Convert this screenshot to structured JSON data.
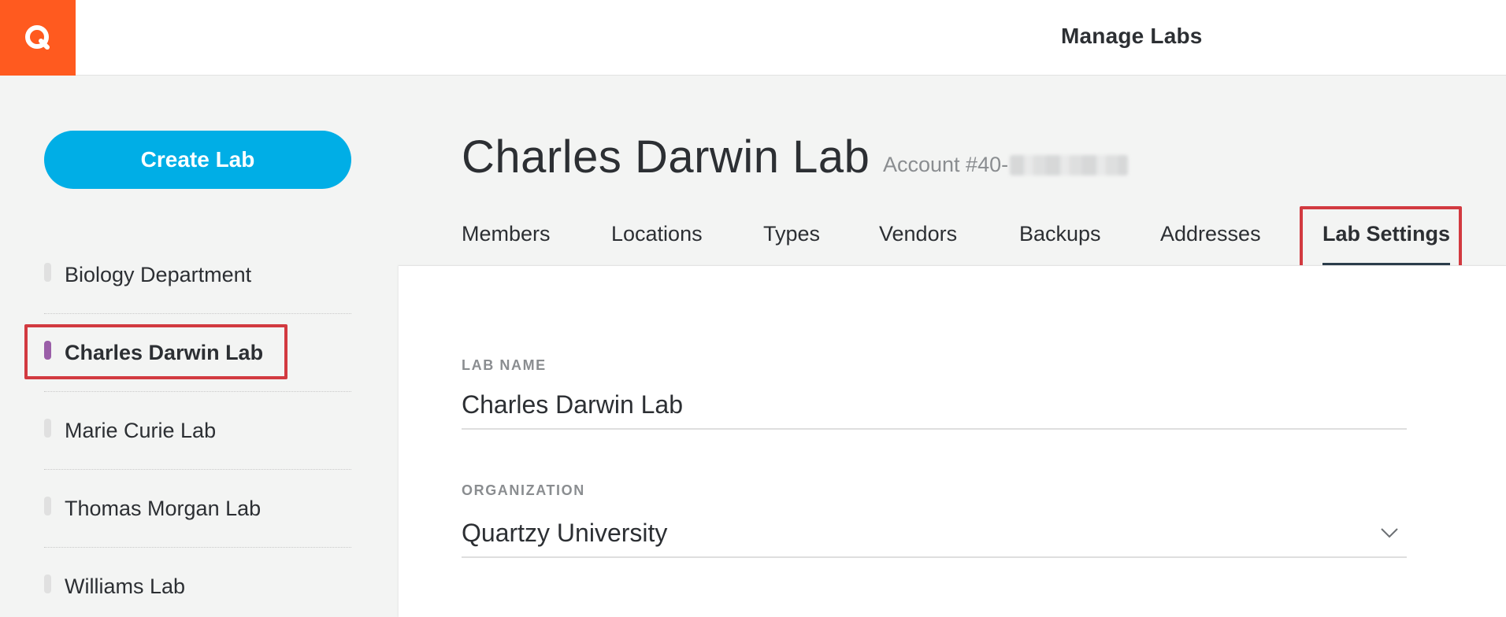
{
  "app": {
    "header_title": "Manage Labs"
  },
  "sidebar": {
    "create_label": "Create Lab",
    "items": [
      {
        "label": "Biology Department",
        "active": false
      },
      {
        "label": "Charles Darwin Lab",
        "active": true
      },
      {
        "label": "Marie Curie Lab",
        "active": false
      },
      {
        "label": "Thomas Morgan Lab",
        "active": false
      },
      {
        "label": "Williams Lab",
        "active": false
      }
    ]
  },
  "main": {
    "title": "Charles Darwin Lab",
    "account_prefix": "Account #40-",
    "tabs": [
      {
        "label": "Members"
      },
      {
        "label": "Locations"
      },
      {
        "label": "Types"
      },
      {
        "label": "Vendors"
      },
      {
        "label": "Backups"
      },
      {
        "label": "Addresses"
      },
      {
        "label": "Lab Settings",
        "active": true
      }
    ],
    "form": {
      "lab_name_label": "LAB NAME",
      "lab_name_value": "Charles Darwin Lab",
      "organization_label": "ORGANIZATION",
      "organization_value": "Quartzy University"
    }
  },
  "colors": {
    "brand": "#ff5a1f",
    "primary_button": "#00aee6",
    "active_lab_marker": "#9a5ea8",
    "highlight": "#d23a40"
  },
  "icons": {
    "logo": "quartzy-q-logo-icon",
    "dropdown": "chevron-down-icon"
  }
}
